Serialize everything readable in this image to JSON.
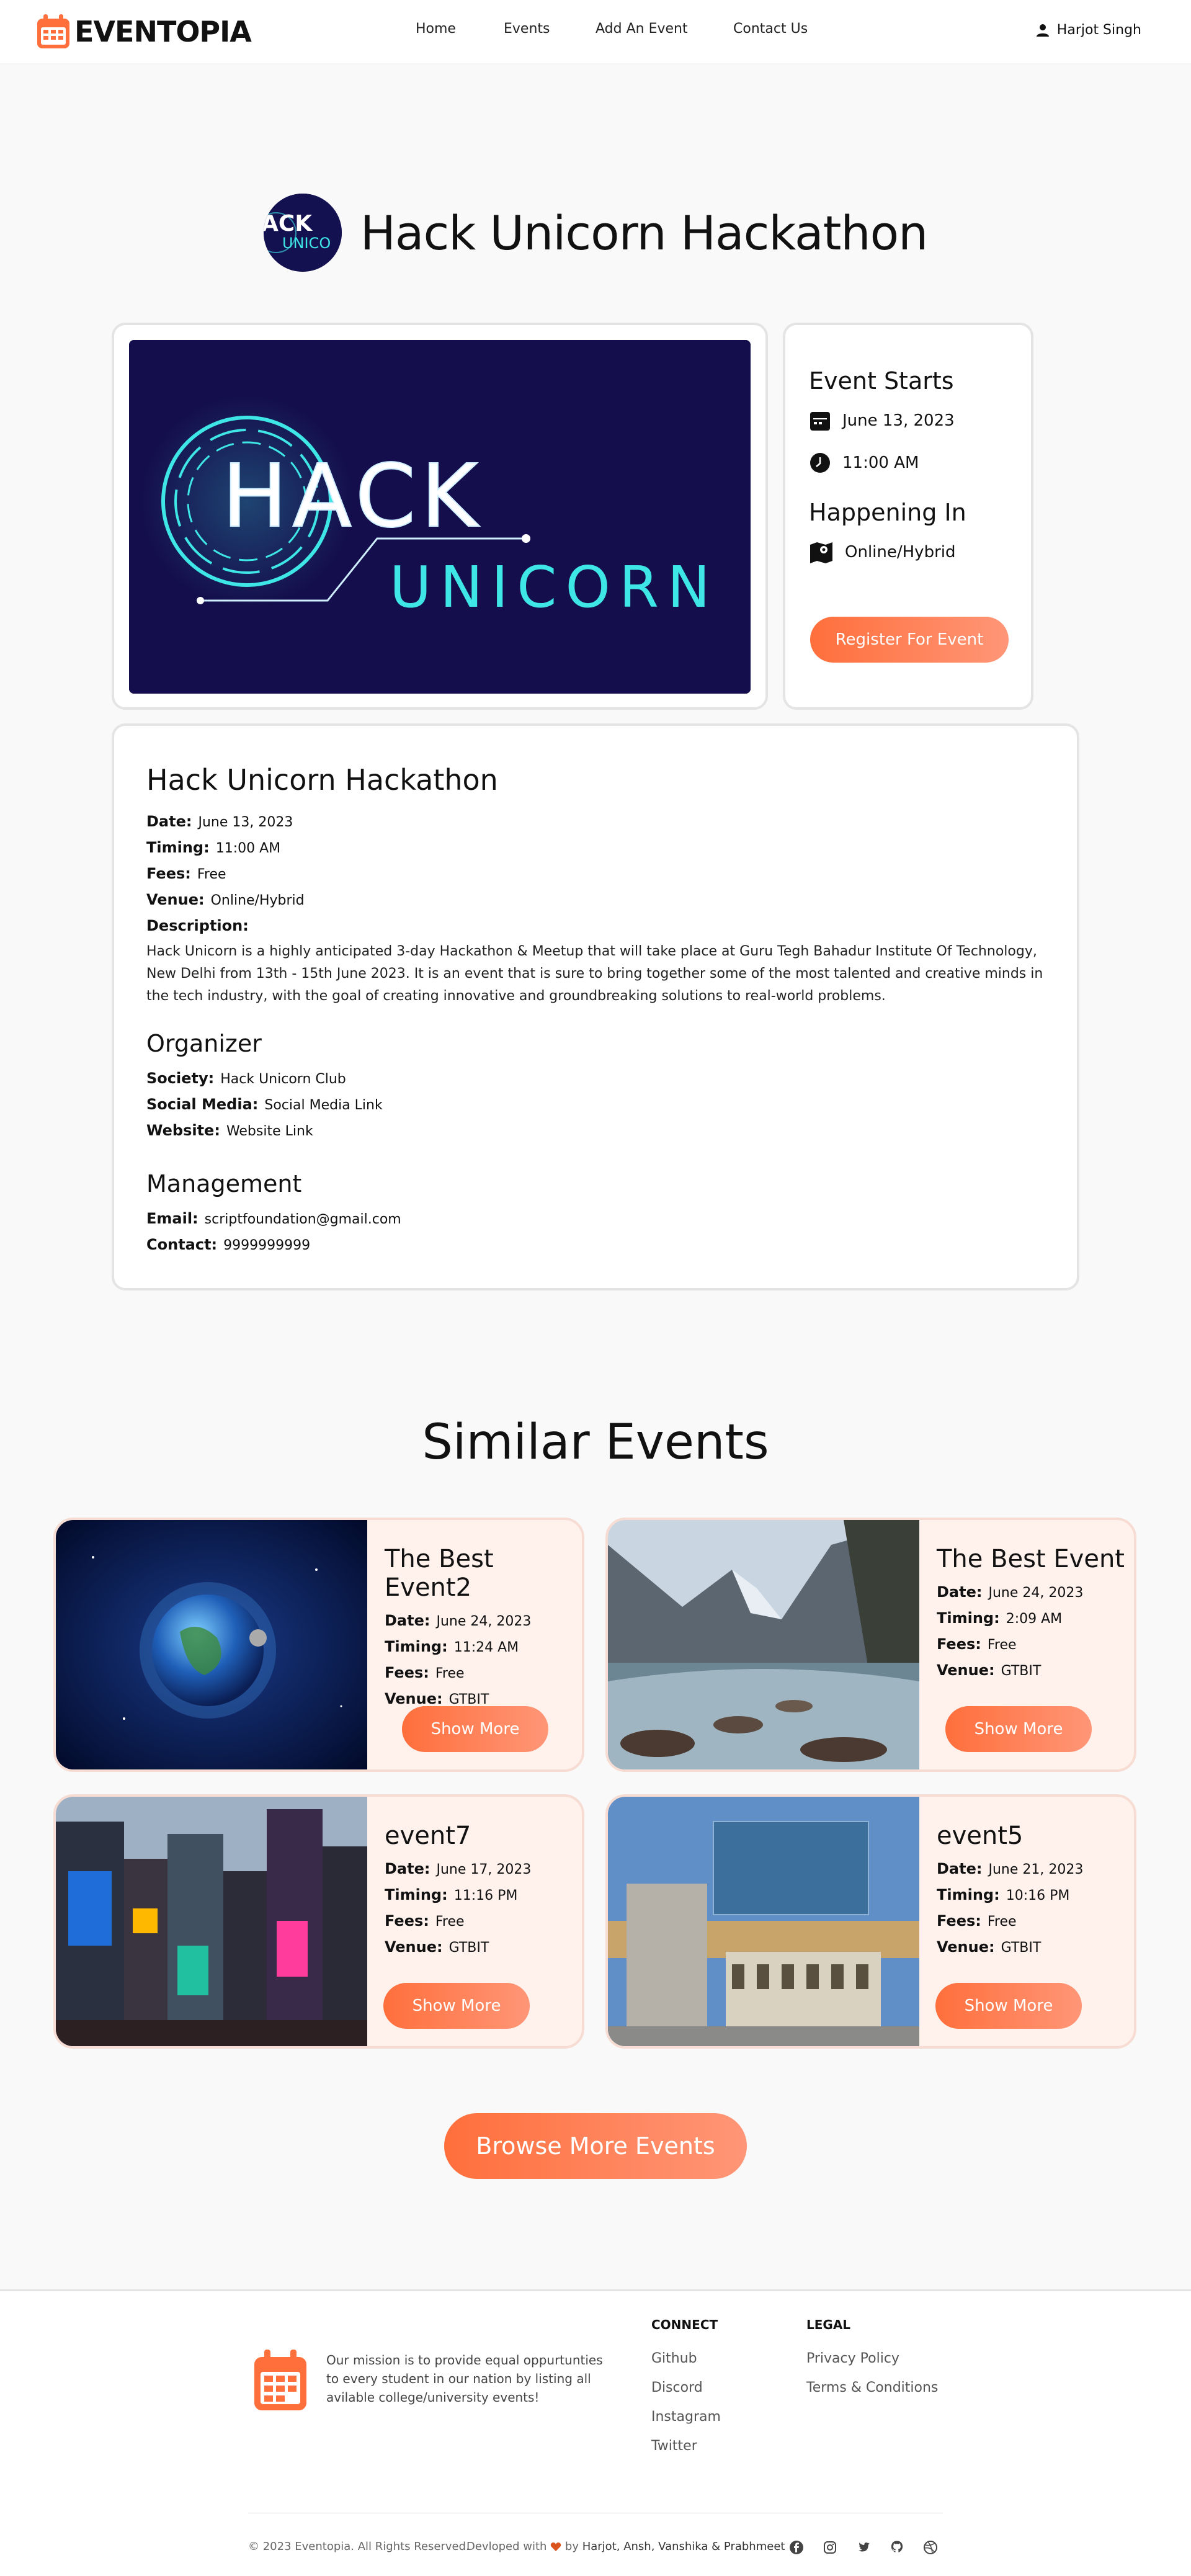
{
  "navbar": {
    "brand": "EVENTOPIA",
    "links": [
      "Home",
      "Events",
      "Add An Event",
      "Contact Us"
    ],
    "user_name": "Harjot Singh"
  },
  "event": {
    "title": "Hack Unicorn Hackathon",
    "avatar_text": "ACK UNICO",
    "banner_line1": "HACK",
    "banner_line2": "UNICORN",
    "starts_heading": "Event Starts",
    "date": "June 13, 2023",
    "time": "11:00 AM",
    "happening_heading": "Happening In",
    "location": "Online/Hybrid",
    "register_label": "Register For Event"
  },
  "details": {
    "title": "Hack Unicorn Hackathon",
    "date_label": "Date:",
    "date": "June 13, 2023",
    "timing_label": "Timing:",
    "timing": "11:00 AM",
    "fees_label": "Fees:",
    "fees": "Free",
    "venue_label": "Venue:",
    "venue": "Online/Hybrid",
    "description_label": "Description:",
    "description": "Hack Unicorn is a highly anticipated 3-day Hackathon & Meetup that will take place at Guru Tegh Bahadur Institute Of Technology, New Delhi from 13th - 15th June 2023. It is an event that is sure to bring together some of the most talented and creative minds in the tech industry, with the goal of creating innovative and groundbreaking solutions to real-world problems.",
    "organizer_heading": "Organizer",
    "society_label": "Society:",
    "society": "Hack Unicorn Club",
    "social_label": "Social Media:",
    "social": "Social Media Link",
    "website_label": "Website:",
    "website": "Website Link",
    "management_heading": "Management",
    "email_label": "Email:",
    "email": "scriptfoundation@gmail.com",
    "contact_label": "Contact:",
    "contact": "9999999999"
  },
  "similar": {
    "heading": "Similar Events",
    "labels": {
      "date": "Date:",
      "timing": "Timing:",
      "fees": "Fees:",
      "venue": "Venue:",
      "button": "Show More"
    },
    "events": [
      {
        "name": "The Best Event2",
        "date": "June 24, 2023",
        "timing": "11:24 AM",
        "fees": "Free",
        "venue": "GTBIT",
        "image": "earth-space-image"
      },
      {
        "name": "The Best Event",
        "date": "June 24, 2023",
        "timing": "2:09 AM",
        "fees": "Free",
        "venue": "GTBIT",
        "image": "mountain-river-image"
      },
      {
        "name": "event7",
        "date": "June 17, 2023",
        "timing": "11:16 PM",
        "fees": "Free",
        "venue": "GTBIT",
        "image": "city-street-image"
      },
      {
        "name": "event5",
        "date": "June 21, 2023",
        "timing": "10:16 PM",
        "fees": "Free",
        "venue": "GTBIT",
        "image": "modern-building-image"
      }
    ],
    "browse_label": "Browse More Events"
  },
  "footer": {
    "mission": "Our mission is to provide equal oppurtunties to every student in our nation by listing all avilable college/university events!",
    "connect_heading": "CONNECT",
    "connect_links": [
      "Github",
      "Discord",
      "Instagram",
      "Twitter"
    ],
    "legal_heading": "LEGAL",
    "legal_links": [
      "Privacy Policy",
      "Terms & Conditions"
    ],
    "copyright": "© 2023 Eventopia. All Rights Reserved.",
    "developed_prefix": "Devloped with",
    "developed_suffix": "by",
    "developers": "Harjot, Ansh, Vanshika & Prabhmeet"
  },
  "colors": {
    "accent": "#ff6f3c",
    "accent_light": "#ff9677",
    "banner_bg": "#140f4c",
    "neon": "#3fe6e6",
    "card_bg": "#fff1ec"
  }
}
